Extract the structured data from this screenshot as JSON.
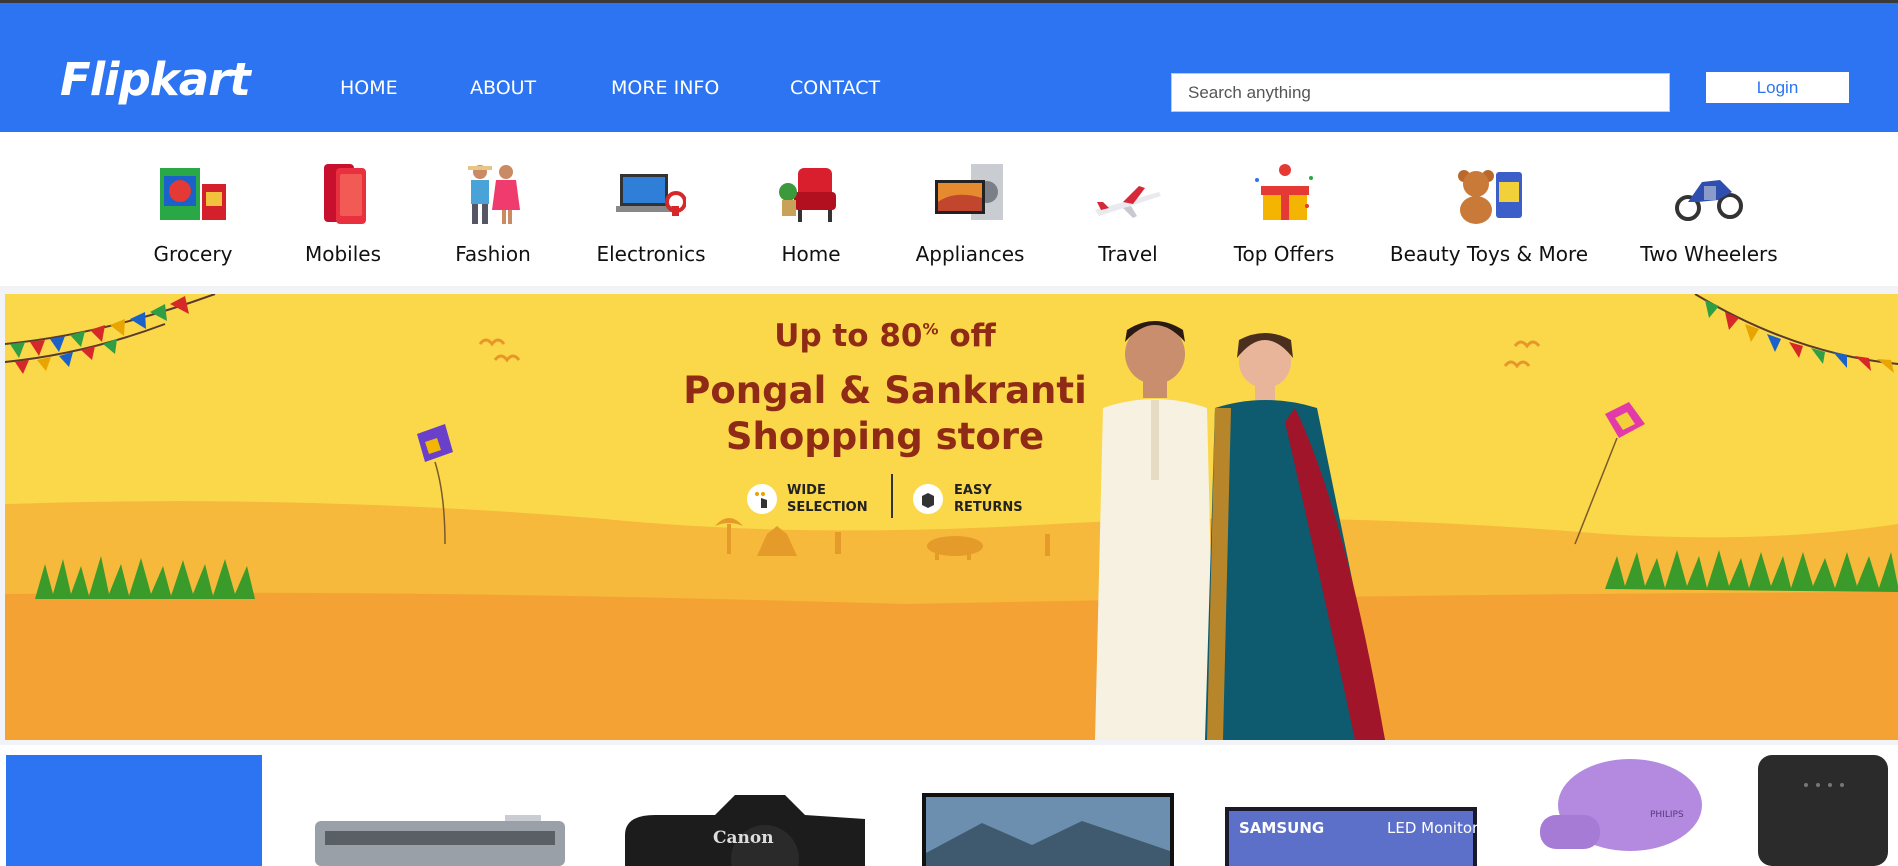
{
  "header": {
    "logo": "Flipkart",
    "nav": [
      "HOME",
      "ABOUT",
      "MORE INFO",
      "CONTACT"
    ],
    "search_placeholder": "Search anything",
    "login_label": "Login"
  },
  "categories": [
    {
      "label": "Grocery",
      "icon": "grocery-icon"
    },
    {
      "label": "Mobiles",
      "icon": "mobile-icon"
    },
    {
      "label": "Fashion",
      "icon": "fashion-icon"
    },
    {
      "label": "Electronics",
      "icon": "laptop-icon"
    },
    {
      "label": "Home",
      "icon": "armchair-icon"
    },
    {
      "label": "Appliances",
      "icon": "appliance-icon"
    },
    {
      "label": "Travel",
      "icon": "airplane-icon"
    },
    {
      "label": "Top Offers",
      "icon": "gift-icon"
    },
    {
      "label": "Beauty Toys & More",
      "icon": "teddy-icon"
    },
    {
      "label": "Two Wheelers",
      "icon": "motorbike-icon"
    }
  ],
  "banner": {
    "offer_line": "Up to 80",
    "offer_pct": "%",
    "offer_suffix": "off",
    "title_line1": "Pongal & Sankranti",
    "title_line2": "Shopping store",
    "feature1_line1": "WIDE",
    "feature1_line2": "SELECTION",
    "feature2_line1": "EASY",
    "feature2_line2": "RETURNS"
  },
  "products": {
    "camera_brand": "Canon",
    "monitor_brand": "SAMSUNG",
    "monitor_label": "LED Monitor",
    "dryer_brand": "PHILIPS"
  },
  "colors": {
    "brand_blue": "#2c74f2",
    "banner_yellow": "#fbd84a",
    "banner_orange": "#f3a233",
    "banner_text": "#8e2a15"
  }
}
